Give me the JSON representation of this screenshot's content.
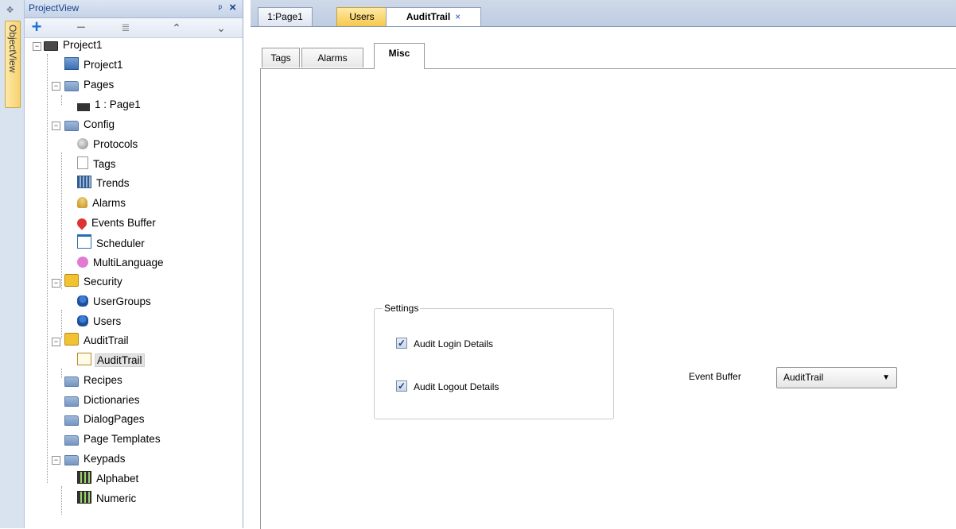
{
  "side_strip": {
    "tab_label": "ObjectView"
  },
  "project_panel": {
    "title": "ProjectView",
    "toolbar": {
      "add": "+",
      "remove": "−",
      "properties": "≣",
      "up": "⌃",
      "down": "⌄"
    },
    "tree": [
      {
        "label": "Project1",
        "icon": "monitor-icon"
      },
      {
        "label": "Project1",
        "icon": "project-settings-icon"
      },
      {
        "label": "Pages",
        "icon": "folder-icon"
      },
      {
        "label": "1 : Page1",
        "icon": "page-icon"
      },
      {
        "label": "Config",
        "icon": "folder-icon"
      },
      {
        "label": "Protocols",
        "icon": "protocols-icon"
      },
      {
        "label": "Tags",
        "icon": "tags-icon"
      },
      {
        "label": "Trends",
        "icon": "trends-icon"
      },
      {
        "label": "Alarms",
        "icon": "bell-icon"
      },
      {
        "label": "Events Buffer",
        "icon": "pin-icon"
      },
      {
        "label": "Scheduler",
        "icon": "scheduler-icon"
      },
      {
        "label": "MultiLanguage",
        "icon": "language-icon"
      },
      {
        "label": "Security",
        "icon": "lock-folder-icon"
      },
      {
        "label": "UserGroups",
        "icon": "usergroups-icon"
      },
      {
        "label": "Users",
        "icon": "users-icon"
      },
      {
        "label": "AuditTrail",
        "icon": "lock-folder-icon"
      },
      {
        "label": "AuditTrail",
        "icon": "audit-icon"
      },
      {
        "label": "Recipes",
        "icon": "folder-icon"
      },
      {
        "label": "Dictionaries",
        "icon": "folder-icon"
      },
      {
        "label": "DialogPages",
        "icon": "folder-icon"
      },
      {
        "label": "Page Templates",
        "icon": "folder-icon"
      },
      {
        "label": "Keypads",
        "icon": "folder-icon"
      },
      {
        "label": "Alphabet",
        "icon": "keypad-icon"
      },
      {
        "label": "Numeric",
        "icon": "keypad-icon"
      }
    ]
  },
  "doc_tabs": {
    "page1": "1:Page1",
    "users": "Users",
    "audit": "AuditTrail",
    "close": "×"
  },
  "inner_tabs": {
    "tags": "Tags",
    "alarms": "Alarms",
    "misc": "Misc"
  },
  "settings": {
    "legend": "Settings",
    "login_label": "Audit Login Details",
    "login_checked": true,
    "logout_label": "Audit Logout Details",
    "logout_checked": true
  },
  "event_buffer": {
    "label": "Event Buffer",
    "value": "AuditTrail"
  }
}
